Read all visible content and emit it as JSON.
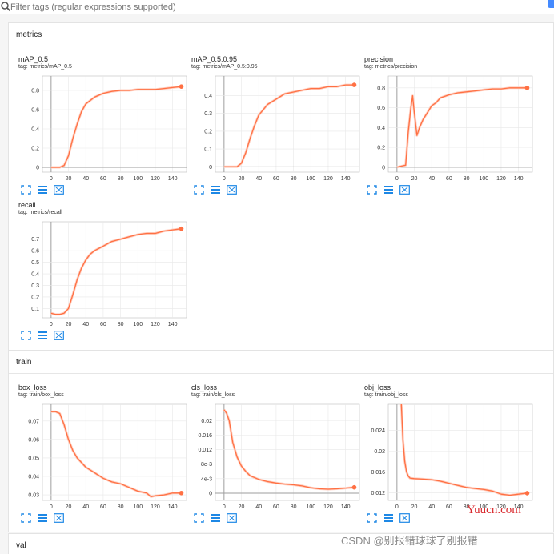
{
  "search": {
    "placeholder": "Filter tags (regular expressions supported)",
    "value": ""
  },
  "sections": [
    {
      "title": "metrics"
    },
    {
      "title": "train"
    },
    {
      "title": "val"
    }
  ],
  "colors": {
    "series": "#ff7043",
    "smoothed_raw": "#ffd0c2",
    "accent": "#448aff",
    "watermark_red": "#d9292d"
  },
  "icons": {
    "search": "search-icon",
    "fit": "fit-domain-icon",
    "log": "toggle-y-log-icon",
    "expand": "expand-chart-icon"
  },
  "cards": [
    {
      "title": "mAP_0.5",
      "tag": "tag: metrics/mAP_0.5",
      "chart_data": {
        "type": "line",
        "x": [
          0,
          10,
          15,
          20,
          25,
          30,
          35,
          40,
          50,
          60,
          70,
          80,
          90,
          100,
          110,
          120,
          130,
          140,
          150
        ],
        "y": [
          0,
          0,
          0.02,
          0.12,
          0.3,
          0.45,
          0.58,
          0.66,
          0.73,
          0.77,
          0.79,
          0.8,
          0.8,
          0.81,
          0.81,
          0.81,
          0.82,
          0.83,
          0.84
        ],
        "xlim": [
          -10,
          156
        ],
        "ylim": [
          -0.05,
          0.95
        ],
        "xticks": [
          0,
          20,
          40,
          60,
          80,
          100,
          120,
          140
        ],
        "yticks": [
          0,
          0.2,
          0.4,
          0.6,
          0.8
        ]
      }
    },
    {
      "title": "mAP_0.5:0.95",
      "tag": "tag: metrics/mAP_0.5:0.95",
      "chart_data": {
        "type": "line",
        "x": [
          0,
          10,
          15,
          20,
          25,
          30,
          35,
          40,
          50,
          60,
          70,
          80,
          90,
          100,
          110,
          120,
          130,
          140,
          150
        ],
        "y": [
          0,
          0,
          0,
          0.02,
          0.08,
          0.16,
          0.23,
          0.29,
          0.35,
          0.38,
          0.41,
          0.42,
          0.43,
          0.44,
          0.44,
          0.45,
          0.45,
          0.46,
          0.46
        ],
        "xlim": [
          -10,
          156
        ],
        "ylim": [
          -0.03,
          0.51
        ],
        "xticks": [
          0,
          20,
          40,
          60,
          80,
          100,
          120,
          140
        ],
        "yticks": [
          0,
          0.1,
          0.2,
          0.3,
          0.4
        ]
      }
    },
    {
      "title": "precision",
      "tag": "tag: metrics/precision",
      "chart_data": {
        "type": "line",
        "x": [
          0,
          10,
          13,
          16,
          18,
          20,
          23,
          26,
          30,
          35,
          40,
          45,
          50,
          60,
          70,
          80,
          90,
          100,
          110,
          120,
          130,
          140,
          150
        ],
        "y": [
          0,
          0.02,
          0.35,
          0.6,
          0.72,
          0.55,
          0.32,
          0.4,
          0.48,
          0.55,
          0.62,
          0.65,
          0.7,
          0.73,
          0.75,
          0.76,
          0.77,
          0.78,
          0.79,
          0.79,
          0.8,
          0.8,
          0.8
        ],
        "xlim": [
          -10,
          156
        ],
        "ylim": [
          -0.05,
          0.92
        ],
        "xticks": [
          0,
          20,
          40,
          60,
          80,
          100,
          120,
          140
        ],
        "yticks": [
          0,
          0.2,
          0.4,
          0.6,
          0.8
        ]
      }
    },
    {
      "title": "recall",
      "tag": "tag: metrics/recall",
      "chart_data": {
        "type": "line",
        "x": [
          0,
          5,
          10,
          15,
          20,
          25,
          30,
          35,
          40,
          45,
          50,
          60,
          70,
          80,
          90,
          100,
          110,
          120,
          130,
          140,
          150
        ],
        "y": [
          0.06,
          0.05,
          0.05,
          0.06,
          0.1,
          0.22,
          0.35,
          0.45,
          0.52,
          0.57,
          0.6,
          0.64,
          0.68,
          0.7,
          0.72,
          0.74,
          0.75,
          0.75,
          0.77,
          0.78,
          0.79
        ],
        "xlim": [
          -10,
          156
        ],
        "ylim": [
          0.02,
          0.85
        ],
        "xticks": [
          0,
          20,
          40,
          60,
          80,
          100,
          120,
          140
        ],
        "yticks": [
          0.1,
          0.2,
          0.3,
          0.4,
          0.5,
          0.6,
          0.7
        ]
      }
    },
    {
      "title": "box_loss",
      "tag": "tag: train/box_loss",
      "chart_data": {
        "type": "line",
        "x": [
          0,
          5,
          10,
          15,
          20,
          25,
          30,
          40,
          50,
          60,
          70,
          80,
          90,
          100,
          110,
          115,
          120,
          130,
          140,
          150
        ],
        "y": [
          0.075,
          0.075,
          0.074,
          0.068,
          0.06,
          0.054,
          0.05,
          0.045,
          0.042,
          0.039,
          0.037,
          0.036,
          0.034,
          0.032,
          0.031,
          0.029,
          0.0295,
          0.03,
          0.031,
          0.031
        ],
        "xlim": [
          -10,
          156
        ],
        "ylim": [
          0.027,
          0.079
        ],
        "xticks": [
          0,
          20,
          40,
          60,
          80,
          100,
          120,
          140
        ],
        "yticks": [
          0.03,
          0.04,
          0.05,
          0.06,
          0.07
        ]
      }
    },
    {
      "title": "cls_loss",
      "tag": "tag: train/cls_loss",
      "chart_data": {
        "type": "line",
        "x": [
          0,
          3,
          6,
          10,
          15,
          20,
          25,
          30,
          40,
          50,
          60,
          70,
          80,
          90,
          100,
          110,
          120,
          130,
          140,
          150
        ],
        "y": [
          0.023,
          0.022,
          0.02,
          0.014,
          0.01,
          0.0075,
          0.006,
          0.0048,
          0.0038,
          0.0032,
          0.0028,
          0.0025,
          0.0023,
          0.002,
          0.0015,
          0.0012,
          0.0011,
          0.0012,
          0.0014,
          0.0016
        ],
        "xlim": [
          -10,
          156
        ],
        "ylim": [
          -0.002,
          0.0245
        ],
        "xticks": [
          0,
          20,
          40,
          60,
          80,
          100,
          120,
          140
        ],
        "yticks": [
          0,
          0.004,
          0.008,
          0.012,
          0.016,
          0.02
        ],
        "ytick_labels": [
          "0",
          "4e-3",
          "8e-3",
          "0.012",
          "0.016",
          "0.02"
        ]
      }
    },
    {
      "title": "obj_loss",
      "tag": "tag: train/obj_loss",
      "chart_data": {
        "type": "line",
        "x": [
          5,
          7,
          9,
          11,
          13,
          15,
          20,
          30,
          40,
          50,
          60,
          70,
          80,
          90,
          100,
          110,
          120,
          130,
          140,
          150
        ],
        "y": [
          0.029,
          0.022,
          0.018,
          0.016,
          0.0152,
          0.0148,
          0.0147,
          0.0146,
          0.0145,
          0.0142,
          0.0138,
          0.0134,
          0.013,
          0.0128,
          0.0126,
          0.0123,
          0.0117,
          0.0115,
          0.0117,
          0.0119
        ],
        "xlim": [
          -10,
          156
        ],
        "ylim": [
          0.0105,
          0.029
        ],
        "xticks": [
          0,
          20,
          40,
          60,
          80,
          100,
          120,
          140
        ],
        "yticks": [
          0.012,
          0.016,
          0.02,
          0.024
        ]
      }
    }
  ],
  "watermarks": {
    "site": "Yuucn.com",
    "csdn": "CSDN @别报错球球了别报错"
  }
}
